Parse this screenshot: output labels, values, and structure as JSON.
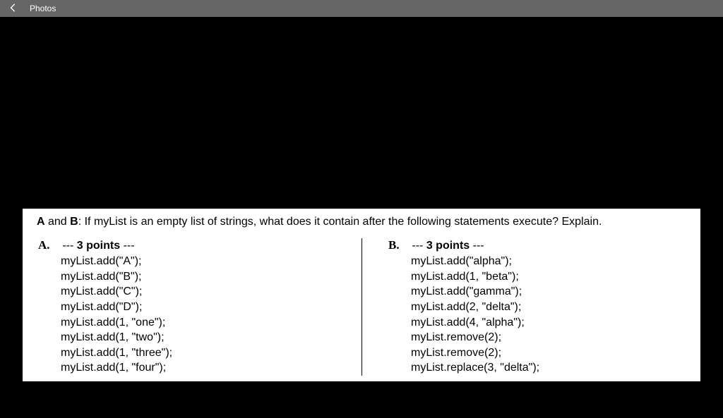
{
  "titlebar": {
    "app_name": "Photos"
  },
  "question": {
    "prefix_bold1": "A",
    "mid": " and ",
    "prefix_bold2": "B",
    "text": ": If myList is an empty list of strings, what does it contain after the following statements execute? Explain."
  },
  "col_a": {
    "label": "A.",
    "points_prefix": "--- ",
    "points_bold": "3 points",
    "points_suffix": " ---",
    "lines": [
      "myList.add(\"A\");",
      "myList.add(\"B\");",
      "myList.add(\"C\");",
      "myList.add(\"D\");",
      "myList.add(1, \"one\");",
      "myList.add(1, \"two\");",
      "myList.add(1, \"three\");",
      "myList.add(1, \"four\");"
    ]
  },
  "col_b": {
    "label": "B.",
    "points_prefix": "--- ",
    "points_bold": "3 points",
    "points_suffix": " ---",
    "lines": [
      "myList.add(\"alpha\");",
      "myList.add(1, \"beta\");",
      "myList.add(\"gamma\");",
      "myList.add(2, \"delta\");",
      "myList.add(4, \"alpha\");",
      "myList.remove(2);",
      "myList.remove(2);",
      "myList.replace(3, \"delta\");"
    ]
  }
}
